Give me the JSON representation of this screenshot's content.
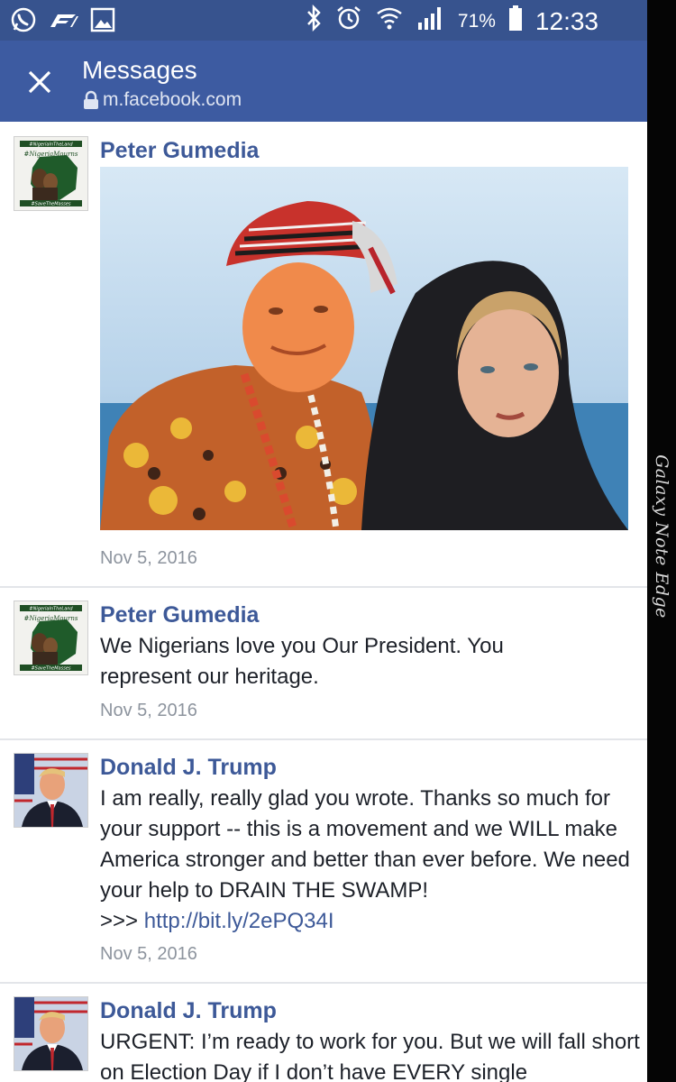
{
  "status_bar": {
    "battery_percent": "71%",
    "time": "12:33",
    "icons": [
      "whatsapp-icon",
      "f1-icon",
      "gallery-icon",
      "bluetooth-icon",
      "alarm-icon",
      "wifi-icon",
      "signal-icon",
      "battery-icon"
    ]
  },
  "app_bar": {
    "title": "Messages",
    "url": "m.facebook.com"
  },
  "device_label": "Galaxy Note Edge",
  "messages": [
    {
      "sender": "Peter Gumedia",
      "type": "photo",
      "time": "Nov 5, 2016"
    },
    {
      "sender": "Peter Gumedia",
      "text": "We Nigerians love you Our President. You represent our heritage.",
      "time": "Nov 5, 2016"
    },
    {
      "sender": "Donald J. Trump",
      "text": "I am really, really glad you wrote. Thanks so much for your support -- this is a movement and we WILL make America stronger and better than ever before. We need your help to DRAIN THE SWAMP!",
      "link_prefix": ">>> ",
      "link": "http://bit.ly/2ePQ34I",
      "time": "Nov 5, 2016"
    },
    {
      "sender": "Donald J. Trump",
      "text": "URGENT: I’m ready to work for you. But we will fall short on Election Day if I don’t have EVERY single"
    }
  ],
  "avatar_text": {
    "top": "#NigeriaInTheLand",
    "middle": "#NigeriaMourns",
    "bottom": "#SaveTheMasses"
  },
  "colors": {
    "brand": "#3d5ba1",
    "statusbar": "#37538e",
    "name": "#3d5998",
    "meta": "#8d949e"
  }
}
